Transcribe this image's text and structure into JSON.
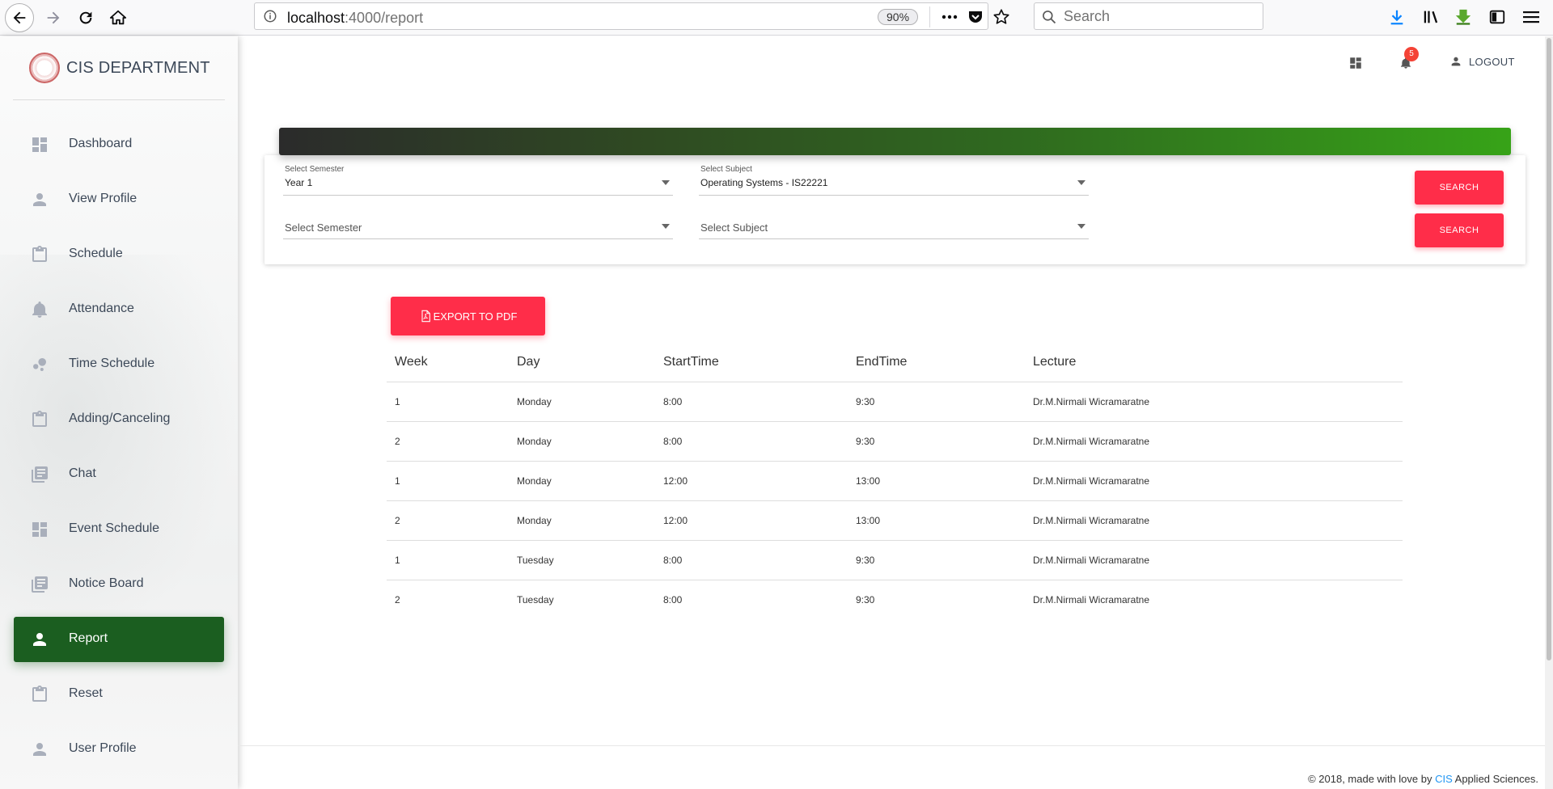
{
  "browser": {
    "url_host": "localhost",
    "url_path": ":4000/report",
    "zoom": "90%",
    "search_placeholder": "Search"
  },
  "sidebar": {
    "brand": "CIS DEPARTMENT",
    "items": [
      {
        "label": "Dashboard",
        "icon": "dashboard-icon",
        "active": false
      },
      {
        "label": "View Profile",
        "icon": "person-icon",
        "active": false
      },
      {
        "label": "Schedule",
        "icon": "clipboard-icon",
        "active": false
      },
      {
        "label": "Attendance",
        "icon": "bell-icon",
        "active": false
      },
      {
        "label": "Time Schedule",
        "icon": "bubble-chart-icon",
        "active": false
      },
      {
        "label": "Adding/Canceling",
        "icon": "clipboard-icon",
        "active": false
      },
      {
        "label": "Chat",
        "icon": "library-books-icon",
        "active": false
      },
      {
        "label": "Event Schedule",
        "icon": "dashboard-icon",
        "active": false
      },
      {
        "label": "Notice Board",
        "icon": "library-books-icon",
        "active": false
      },
      {
        "label": "Report",
        "icon": "person-icon",
        "active": true
      },
      {
        "label": "Reset",
        "icon": "clipboard-icon",
        "active": false
      },
      {
        "label": "User Profile",
        "icon": "person-icon",
        "active": false
      }
    ]
  },
  "topbar": {
    "notification_count": "5",
    "logout_label": "LOGOUT"
  },
  "filters": {
    "row1": {
      "semester_label": "Select Semester",
      "semester_value": "Year 1",
      "subject_label": "Select Subject",
      "subject_value": "Operating Systems - IS22221",
      "search_label": "SEARCH"
    },
    "row2": {
      "semester_placeholder": "Select Semester",
      "subject_placeholder": "Select Subject",
      "search_label": "SEARCH"
    }
  },
  "export_label": "EXPORT TO PDF",
  "table": {
    "headers": [
      "Week",
      "Day",
      "StartTime",
      "EndTime",
      "Lecture"
    ],
    "rows": [
      [
        "1",
        "Monday",
        "8:00",
        "9:30",
        "Dr.M.Nirmali Wicramaratne"
      ],
      [
        "2",
        "Monday",
        "8:00",
        "9:30",
        "Dr.M.Nirmali Wicramaratne"
      ],
      [
        "1",
        "Monday",
        "12:00",
        "13:00",
        "Dr.M.Nirmali Wicramaratne"
      ],
      [
        "2",
        "Monday",
        "12:00",
        "13:00",
        "Dr.M.Nirmali Wicramaratne"
      ],
      [
        "1",
        "Tuesday",
        "8:00",
        "9:30",
        "Dr.M.Nirmali Wicramaratne"
      ],
      [
        "2",
        "Tuesday",
        "8:00",
        "9:30",
        "Dr.M.Nirmali Wicramaratne"
      ]
    ]
  },
  "footer": {
    "prefix": "© 2018, made with love by ",
    "link": "CIS",
    "suffix": " Applied Sciences."
  },
  "colors": {
    "accent": "#ff2d49",
    "active_nav": "#1b5e20",
    "header_gradient_end": "#37a318"
  }
}
